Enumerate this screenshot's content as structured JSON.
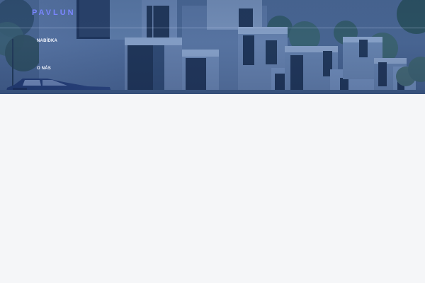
{
  "header": {
    "brand": "PAVLUN"
  },
  "nav": {
    "items": [
      {
        "label": "NABÍDKA"
      },
      {
        "label": "O NÁS"
      }
    ]
  },
  "hero": {
    "image": "modern-houses-photo"
  },
  "colors": {
    "brand": "#7a86ff",
    "hero_tint": "#3f5b86",
    "page_background": "#f5f6f8",
    "nav_text": "#f5f8ff"
  }
}
